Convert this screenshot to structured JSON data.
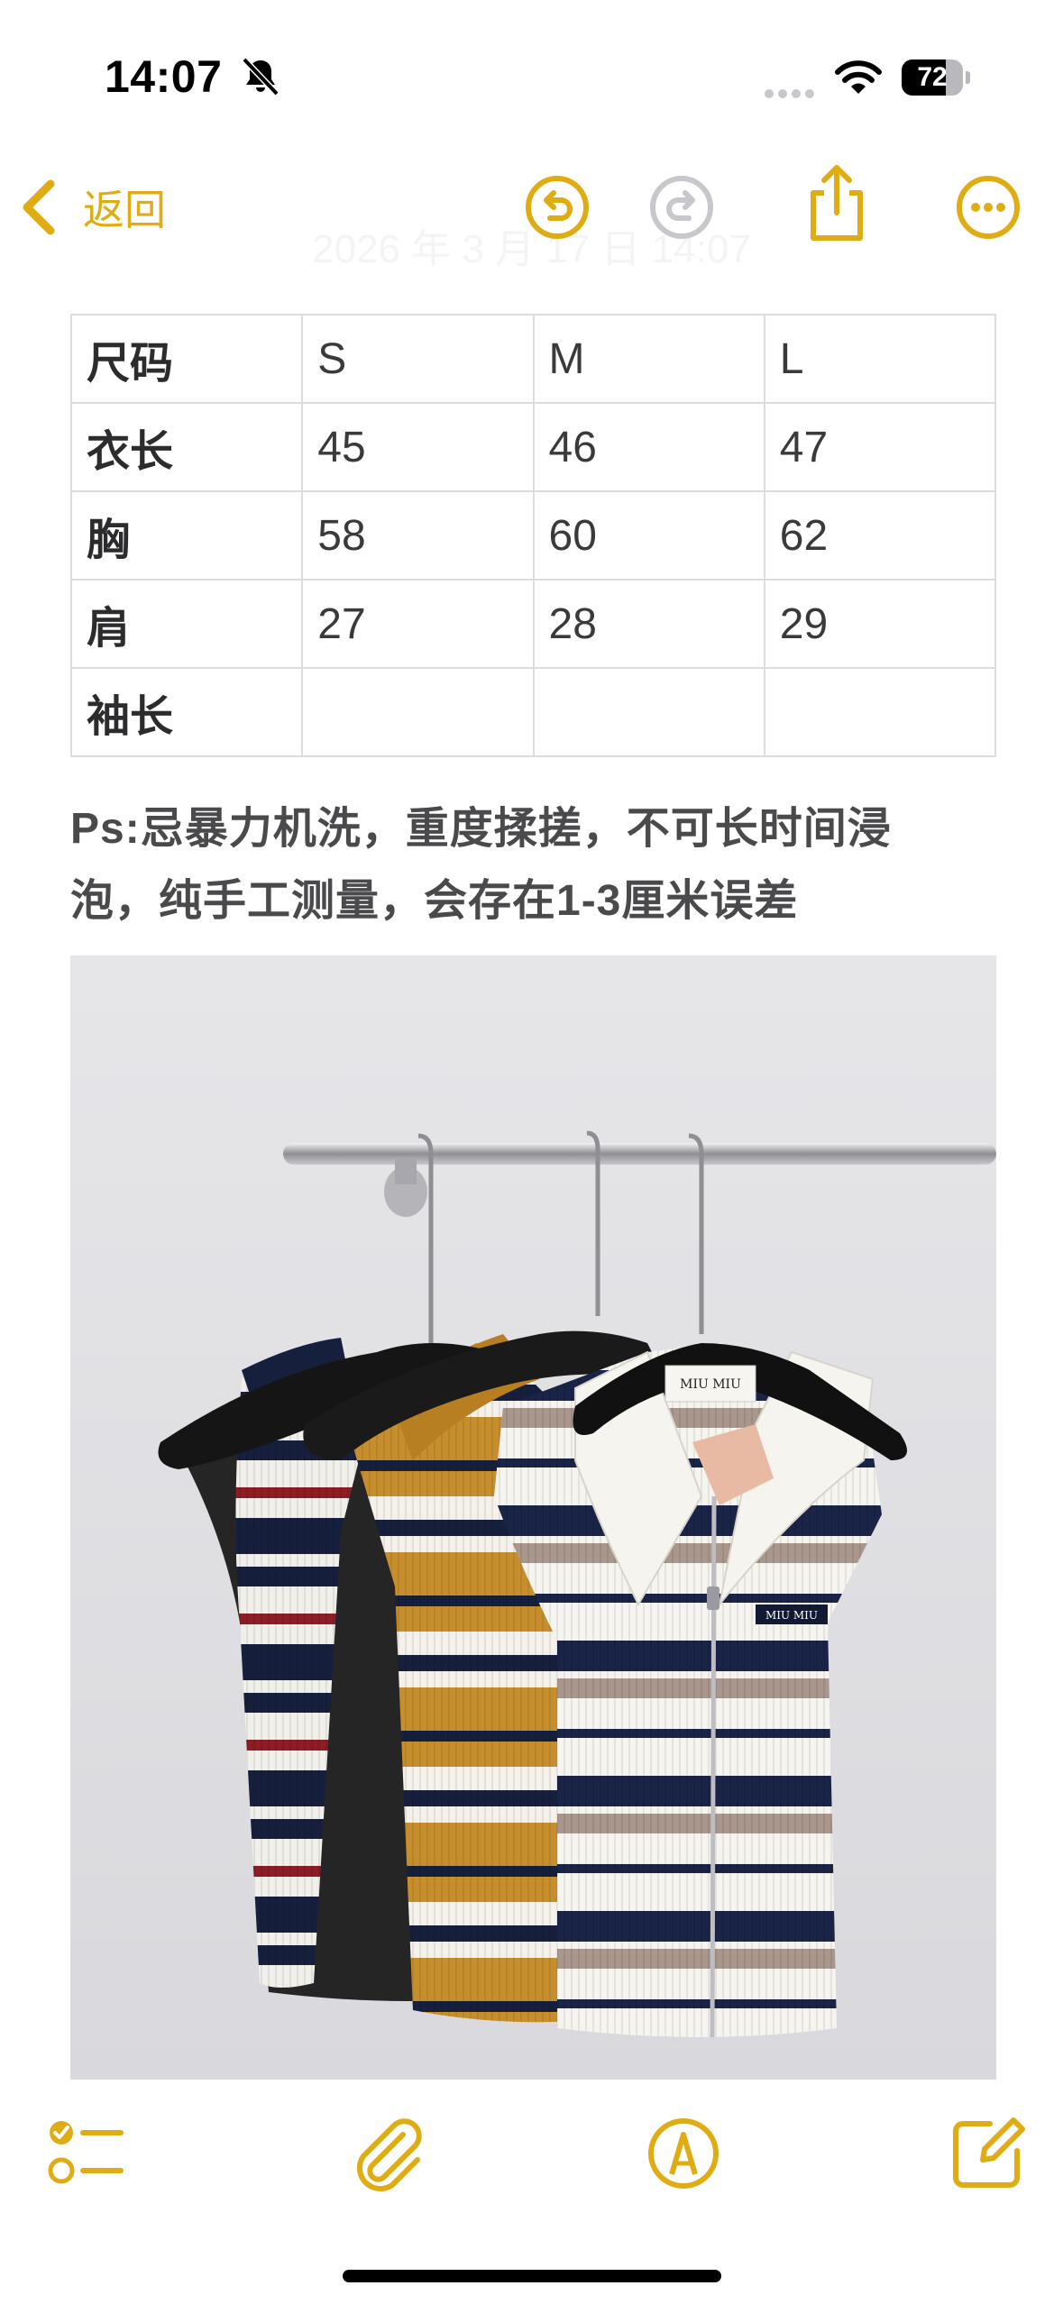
{
  "status_bar": {
    "time": "14:07",
    "battery_level": 72,
    "battery_label": "72"
  },
  "nav": {
    "back_label": "返回",
    "date": "2026 年 3 月 17 日 14:07"
  },
  "size_table": {
    "rows": [
      [
        "尺码",
        "S",
        "M",
        "L"
      ],
      [
        "衣长",
        "45",
        "46",
        "47"
      ],
      [
        "胸",
        "58",
        "60",
        "62"
      ],
      [
        "肩",
        "27",
        "28",
        "29"
      ],
      [
        "袖长",
        "",
        "",
        ""
      ]
    ]
  },
  "note": {
    "line1": "Ps:忌暴力机洗，重度揉搓，不可长时间浸",
    "line2": "泡，纯手工测量，会存在1-3厘米误差"
  },
  "photo": {
    "label_text": "MIU MIU"
  },
  "icons": {
    "accent_color": "#e0ac13",
    "disabled_color": "#c7c7cc",
    "names": [
      "bell-slash-icon",
      "wifi-icon",
      "undo-icon",
      "redo-icon",
      "share-icon",
      "more-icon",
      "checklist-icon",
      "paperclip-icon",
      "markup-icon",
      "compose-icon"
    ]
  }
}
